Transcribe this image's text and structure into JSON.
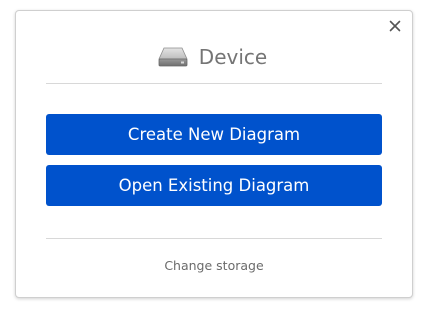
{
  "dialog": {
    "title": "Device",
    "title_icon": "hard-drive-icon",
    "close_icon": "close-icon",
    "buttons": {
      "create_label": "Create New Diagram",
      "open_label": "Open Existing Diagram"
    },
    "change_storage_label": "Change storage"
  },
  "colors": {
    "primary_button": "#0052cc",
    "button_text": "#ffffff",
    "title_text": "#757575",
    "link_text": "#6b6b6b"
  }
}
